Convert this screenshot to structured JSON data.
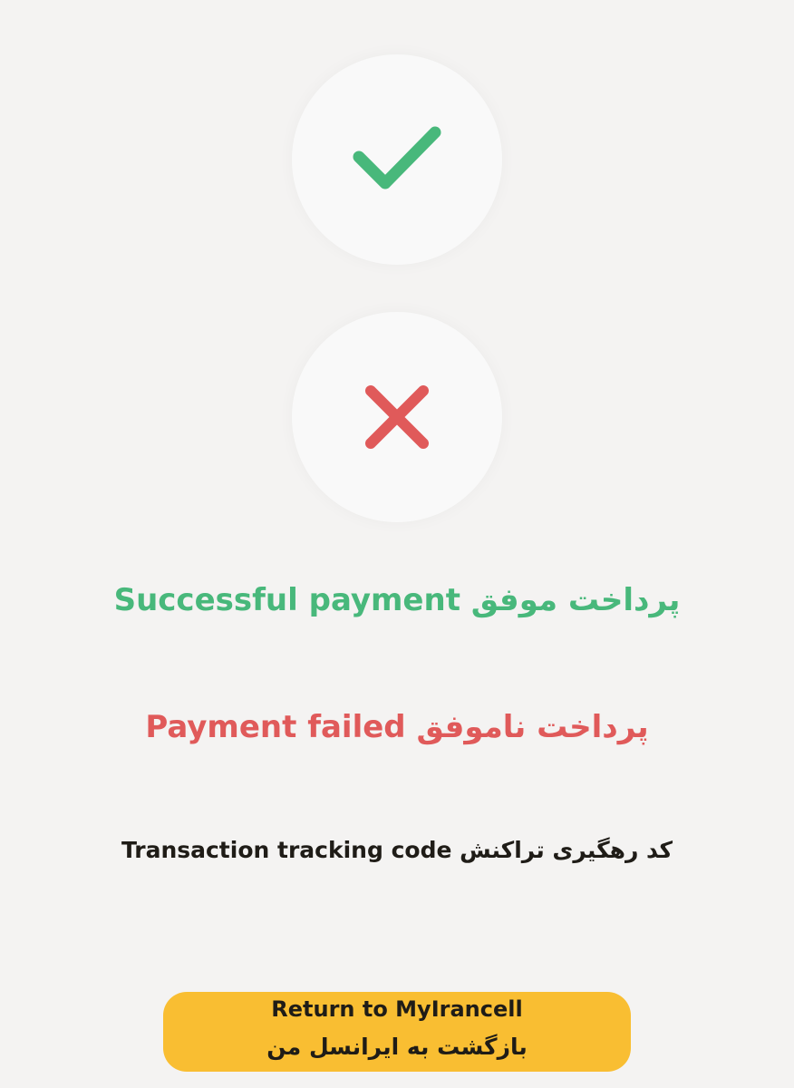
{
  "colors": {
    "background": "#f4f3f2",
    "success": "#48b87b",
    "failed": "#e05a5a",
    "text_dark": "#1f1c17",
    "button": "#f9be32"
  },
  "icons": {
    "success": "checkmark-icon",
    "failed": "cross-icon"
  },
  "status": {
    "success_text": "پرداخت موفق Successful payment",
    "failed_text": "پرداخت ناموفق Payment failed"
  },
  "tracking": {
    "label": "کد رهگیری تراکنش Transaction tracking code"
  },
  "return_button": {
    "label_en": "Return to MyIrancell",
    "label_fa": "بازگشت به ایرانسل من"
  }
}
